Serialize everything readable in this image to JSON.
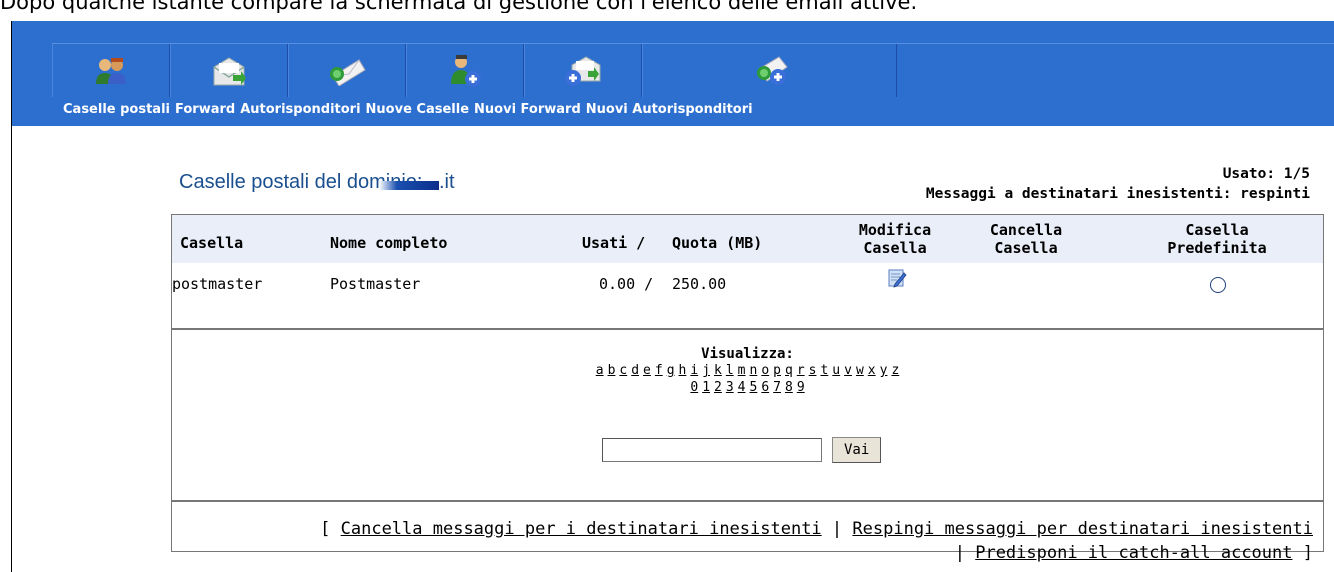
{
  "caption": "Dopo qualche istante compare la schermata di gestione con l'elenco delle email attive.",
  "nav": {
    "items": [
      {
        "label": "Caselle postali",
        "icon": "users-mailbox-icon"
      },
      {
        "label": "Forward",
        "icon": "mail-forward-icon"
      },
      {
        "label": "Autorisponditori",
        "icon": "auto-reply-icon"
      },
      {
        "label": "Nuove Caselle",
        "icon": "add-user-icon"
      },
      {
        "label": "Nuovi Forward",
        "icon": "new-forward-icon"
      },
      {
        "label": "Nuovi Autorisponditori",
        "icon": "new-auto-reply-icon"
      }
    ]
  },
  "header": {
    "title": "Caselle postali del dominio:",
    "domain_suffix": ".it",
    "usage": "Usato: 1/5",
    "bounce_status": "Messaggi a destinatari inesistenti: respinti"
  },
  "table": {
    "columns": {
      "casella": "Casella",
      "nome": "Nome completo",
      "usati": "Usati /",
      "quota": "Quota (MB)",
      "modifica_1": "Modifica",
      "modifica_2": "Casella",
      "cancella_1": "Cancella",
      "cancella_2": "Casella",
      "predef_1": "Casella",
      "predef_2": "Predefinita"
    },
    "rows": [
      {
        "casella": "postmaster",
        "nome": "Postmaster",
        "usati": "0.00 /",
        "quota": "250.00"
      }
    ]
  },
  "filter": {
    "title": "Visualizza:",
    "letters": [
      "a",
      "b",
      "c",
      "d",
      "e",
      "f",
      "g",
      "h",
      "i",
      "j",
      "k",
      "l",
      "m",
      "n",
      "o",
      "p",
      "q",
      "r",
      "s",
      "t",
      "u",
      "v",
      "w",
      "x",
      "y",
      "z"
    ],
    "digits": [
      "0",
      "1",
      "2",
      "3",
      "4",
      "5",
      "6",
      "7",
      "8",
      "9"
    ],
    "search_value": "",
    "go_label": "Vai"
  },
  "footer": {
    "open_bracket": "[",
    "link1": "Cancella messaggi per i destinatari inesistenti",
    "sep1": "|",
    "link2": "Respingi messaggi per destinatari inesistenti",
    "sep2": "|",
    "link3": "Predisponi il catch-all account",
    "close_bracket": "]"
  }
}
